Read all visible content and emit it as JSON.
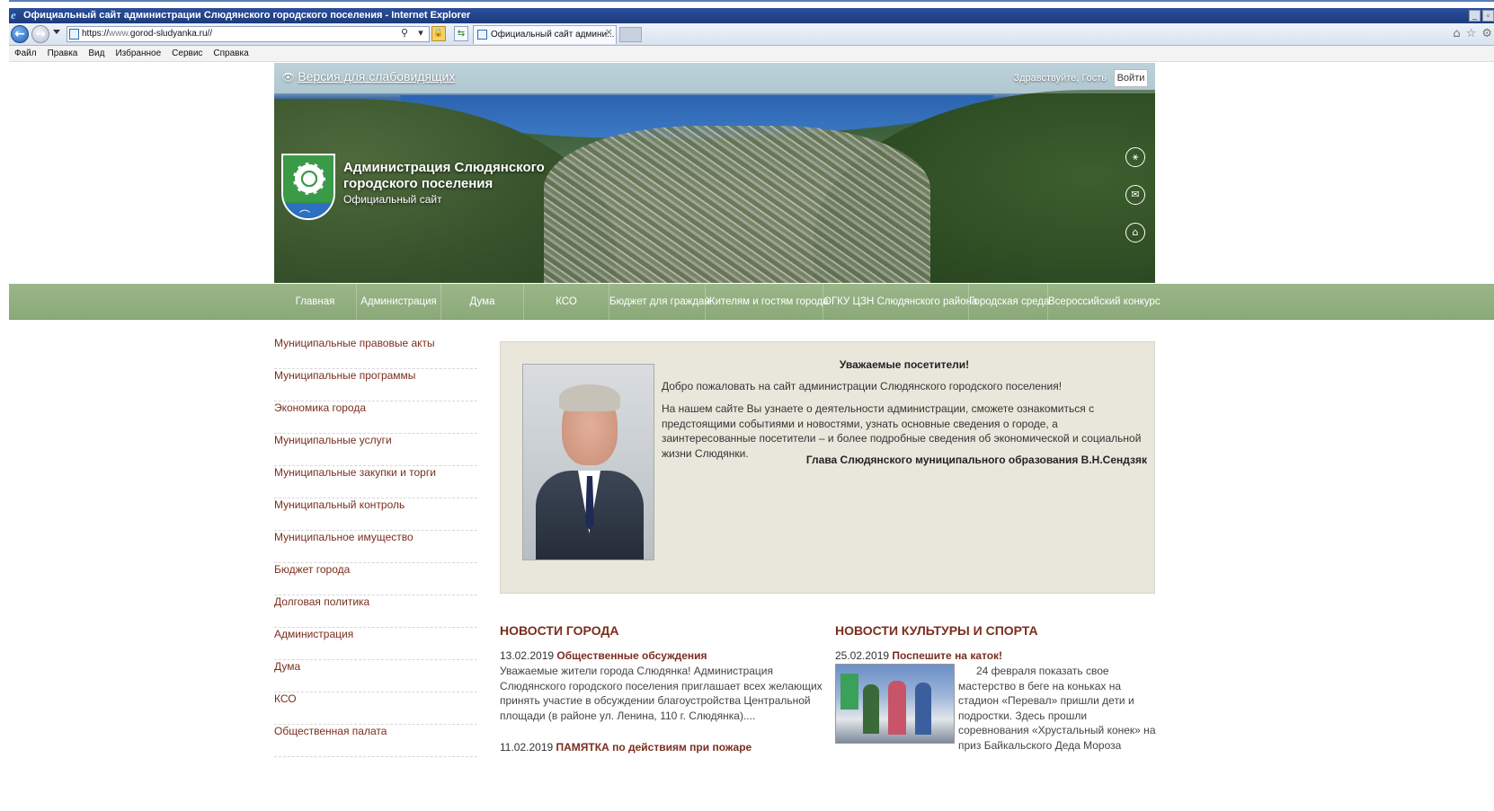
{
  "browser": {
    "title": "Официальный сайт администрации Слюдянского городского поселения - Internet Explorer",
    "url_scheme": "https://",
    "url_host": "www.",
    "url_rest": "gorod-sludyanka.ru//",
    "tab_title": "Официальный сайт админи...",
    "menu": [
      "Файл",
      "Правка",
      "Вид",
      "Избранное",
      "Сервис",
      "Справка"
    ],
    "icons": [
      "home-icon",
      "star-icon",
      "gear-icon"
    ]
  },
  "header": {
    "vision_link": "Версия для слабовидящих",
    "greeting": "Здравствуйте, Гость",
    "login_label": "Войти",
    "org_name": "Администрация Слюдянского городского поселения",
    "org_subtitle": "Официальный сайт",
    "side_icons": [
      "sitemap-icon",
      "mail-icon",
      "home-icon"
    ]
  },
  "nav": [
    {
      "label": "Главная"
    },
    {
      "label": "Администрация"
    },
    {
      "label": "Дума"
    },
    {
      "label": "КСО"
    },
    {
      "label": "Бюджет для граждан"
    },
    {
      "label": "Жителям и гостям города"
    },
    {
      "label": "ОГКУ ЦЗН Слюдянского района"
    },
    {
      "label": "Городская среда"
    },
    {
      "label": "Всероссийский конкурс"
    }
  ],
  "sidebar": [
    "Муниципальные правовые акты",
    "Муниципальные программы",
    "Экономика города",
    "Муниципальные услуги",
    "Муниципальные закупки и торги",
    "Муниципальный контроль",
    "Муниципальное имущество",
    "Бюджет города",
    "Долговая политика",
    "Администрация",
    "Дума",
    "КСО",
    "Общественная палата"
  ],
  "welcome": {
    "title": "Уважаемые посетители!",
    "p1": "Добро пожаловать на сайт администрации Слюдянского городского поселения!",
    "p2": "На нашем сайте Вы узнаете о деятельности администрации, сможете ознакомиться с предстоящими событиями и новостями, узнать основные сведения о городе, а заинтересованные посетители – и более подробные сведения об экономической и социальной жизни Слюдянки.",
    "signature": "Глава Слюдянского муниципального образования В.Н.Сендзяк"
  },
  "news_city": {
    "heading": "НОВОСТИ ГОРОДА",
    "items": [
      {
        "date": "13.02.2019",
        "title": "Общественные обсуждения",
        "text": "Уважаемые жители города Слюдянка! Администрация Слюдянского городского поселения приглашает всех желающих принять участие в обсуждении благоустройства Центральной площади (в районе ул. Ленина, 110 г. Слюдянка)...."
      },
      {
        "date": "11.02.2019",
        "title": "ПАМЯТКА по действиям при пожаре",
        "text": ""
      }
    ]
  },
  "news_culture": {
    "heading": "НОВОСТИ КУЛЬТУРЫ И СПОРТА",
    "items": [
      {
        "date": "25.02.2019",
        "title": "Поспешите на каток!",
        "text": "24 февраля показать свое мастерство в беге на коньках на стадион «Перевал» пришли дети и подростки. Здесь прошли соревнования «Хрустальный конек» на приз Байкальского Деда Мороза"
      }
    ]
  },
  "colors": {
    "nav_green": "#8aa978",
    "link_brown": "#7a2e1e",
    "welcome_bg": "#e9e7dc"
  }
}
